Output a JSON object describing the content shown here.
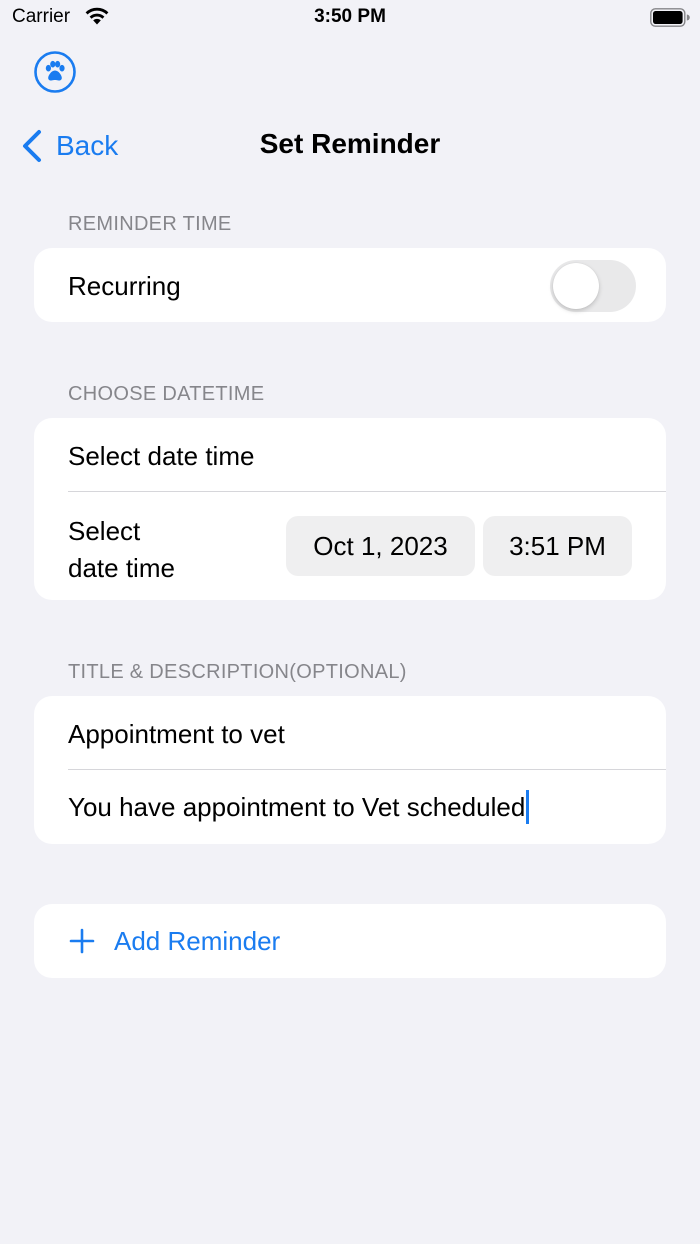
{
  "status_bar": {
    "carrier": "Carrier",
    "time": "3:50 PM"
  },
  "header": {
    "app_icon": "paw-icon",
    "back_label": "Back",
    "title": "Set Reminder"
  },
  "reminder_time": {
    "section_title": "REMINDER TIME",
    "recurring_label": "Recurring",
    "recurring_on": false
  },
  "choose_datetime": {
    "section_title": "CHOOSE DATETIME",
    "row1_label": "Select date time",
    "row2_label_line1": "Select",
    "row2_label_line2": "date time",
    "date_value": "Oct 1, 2023",
    "time_value": "3:51 PM"
  },
  "title_description": {
    "section_title": "TITLE & DESCRIPTION(OPTIONAL)",
    "title_value": "Appointment to vet",
    "description_value": "You have appointment to Vet scheduled"
  },
  "actions": {
    "add_reminder_label": "Add Reminder"
  },
  "colors": {
    "accent": "#1a7cf0",
    "background": "#f2f2f7",
    "card": "#ffffff",
    "secondary_text": "#86868b"
  }
}
